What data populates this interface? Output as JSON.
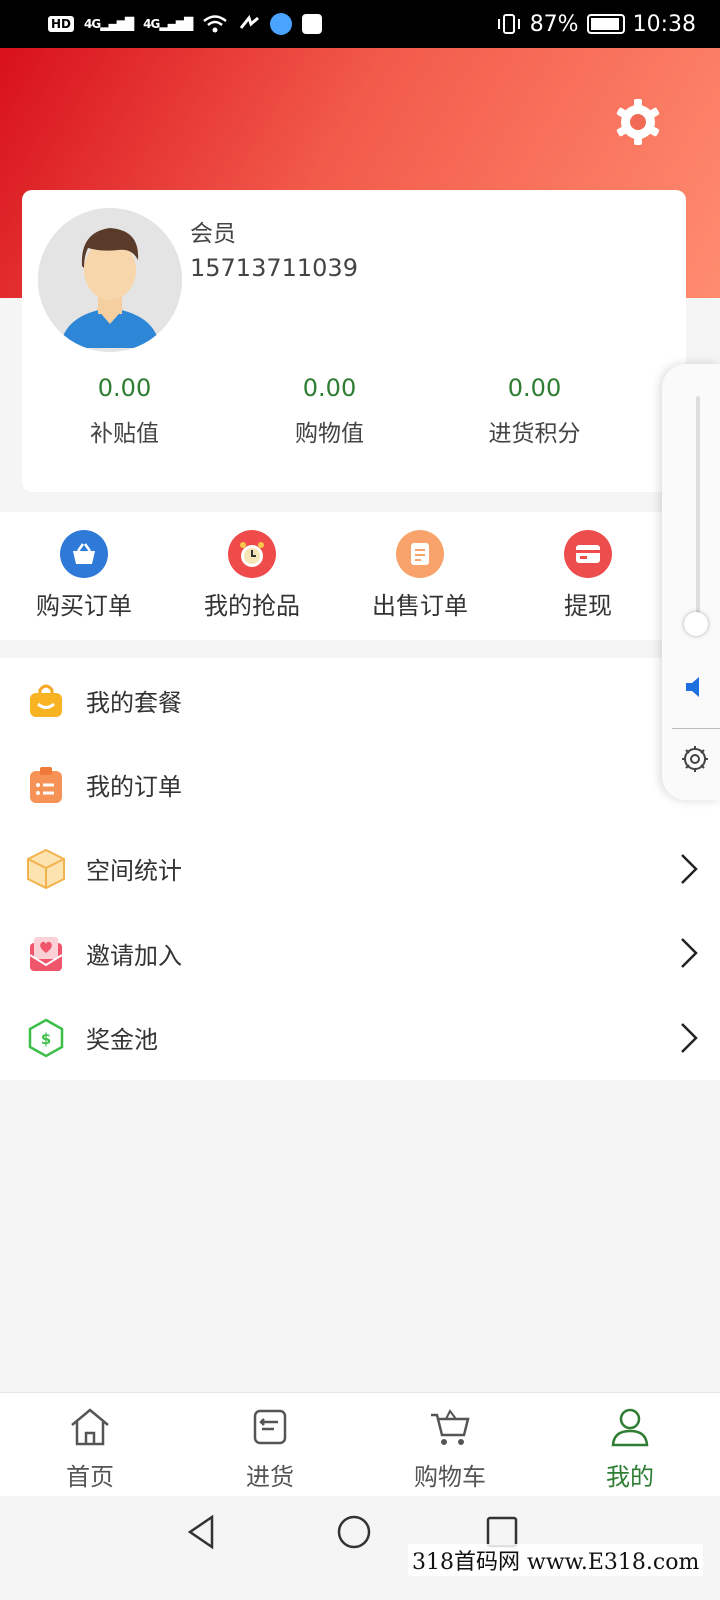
{
  "status_bar": {
    "left": [
      "HD",
      "4G",
      "4G"
    ],
    "battery": "87%",
    "time": "10:38"
  },
  "header": {
    "settings_icon": "gear-icon",
    "accent": "#e8322c"
  },
  "profile": {
    "role": "会员",
    "phone": "15713711039",
    "stats": [
      {
        "value": "0.00",
        "label": "补贴值"
      },
      {
        "value": "0.00",
        "label": "购物值"
      },
      {
        "value": "0.00",
        "label": "进货积分"
      }
    ]
  },
  "quick_actions": [
    {
      "label": "购买订单",
      "icon": "basket-icon",
      "color": "#2f7ad9"
    },
    {
      "label": "我的抢品",
      "icon": "alarm-clock-icon",
      "color": "#ef4b4b"
    },
    {
      "label": "出售订单",
      "icon": "document-icon",
      "color": "#f7a36b"
    },
    {
      "label": "提现",
      "icon": "card-icon",
      "color": "#ee4d4d"
    }
  ],
  "menu": [
    {
      "label": "我的套餐",
      "icon": "shopping-bag-icon"
    },
    {
      "label": "我的订单",
      "icon": "clipboard-list-icon"
    },
    {
      "label": "空间统计",
      "icon": "box-icon"
    },
    {
      "label": "邀请加入",
      "icon": "heart-envelope-icon"
    },
    {
      "label": "奖金池",
      "icon": "money-hexagon-icon"
    }
  ],
  "bottom_nav": [
    {
      "label": "首页",
      "icon": "home-icon"
    },
    {
      "label": "进货",
      "icon": "stock-in-icon"
    },
    {
      "label": "购物车",
      "icon": "cart-icon"
    },
    {
      "label": "我的",
      "icon": "user-icon",
      "active": true
    }
  ],
  "watermark": "318首码网 www.E318.com"
}
